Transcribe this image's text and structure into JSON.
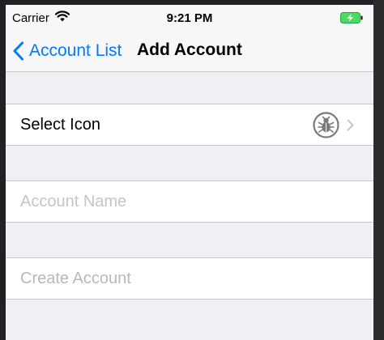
{
  "status_bar": {
    "carrier": "Carrier",
    "time": "9:21 PM",
    "wifi_icon": "wifi-icon",
    "battery_icon": "battery-charging-icon"
  },
  "nav": {
    "back_label": "Account List",
    "title": "Add Account"
  },
  "rows": {
    "select_icon_label": "Select Icon",
    "selected_icon": "bug-icon",
    "account_name_value": "",
    "account_name_placeholder": "Account Name",
    "create_label": "Create Account"
  },
  "colors": {
    "accent": "#007aff",
    "background": "#efeff4",
    "cell": "#ffffff",
    "separator": "#c8c7cc",
    "placeholder": "#c4c4c9",
    "battery": "#4cd964"
  }
}
